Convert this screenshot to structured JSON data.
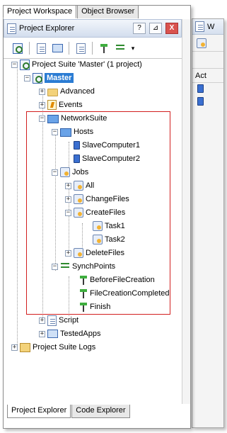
{
  "top_tabs": [
    {
      "label": "Project Workspace",
      "active": true
    },
    {
      "label": "Object Browser",
      "active": false
    }
  ],
  "panel": {
    "title": "Project Explorer",
    "help_label": "?",
    "pin_label": "⊿",
    "close_label": "X"
  },
  "toolbar": {
    "icons": [
      "suite-icon",
      "new-item-icon",
      "properties-icon",
      "document-icon",
      "run-icon",
      "run-suite-icon",
      "dropdown-arrow-icon"
    ]
  },
  "tree": {
    "suite": "Project Suite 'Master' (1 project)",
    "master": "Master",
    "advanced": "Advanced",
    "events": "Events",
    "networksuite": "NetworkSuite",
    "hosts": "Hosts",
    "slave1": "SlaveComputer1",
    "slave2": "SlaveComputer2",
    "jobs": "Jobs",
    "all": "All",
    "changefiles": "ChangeFiles",
    "createfiles": "CreateFiles",
    "task1": "Task1",
    "task2": "Task2",
    "deletefiles": "DeleteFiles",
    "synchpoints": "SynchPoints",
    "beforefilecreation": "BeforeFileCreation",
    "filecreationcompleted": "FileCreationCompleted",
    "finish": "Finish",
    "script": "Script",
    "testedapps": "TestedApps",
    "logs": "Project Suite Logs"
  },
  "bottom_tabs": [
    {
      "label": "Project Explorer",
      "active": true
    },
    {
      "label": "Code Explorer",
      "active": false
    }
  ],
  "right_panel": {
    "header_label": "W",
    "column_label": "Act"
  },
  "colors": {
    "selection": "#2b7cd3",
    "highlight_border": "#d21f1f"
  }
}
